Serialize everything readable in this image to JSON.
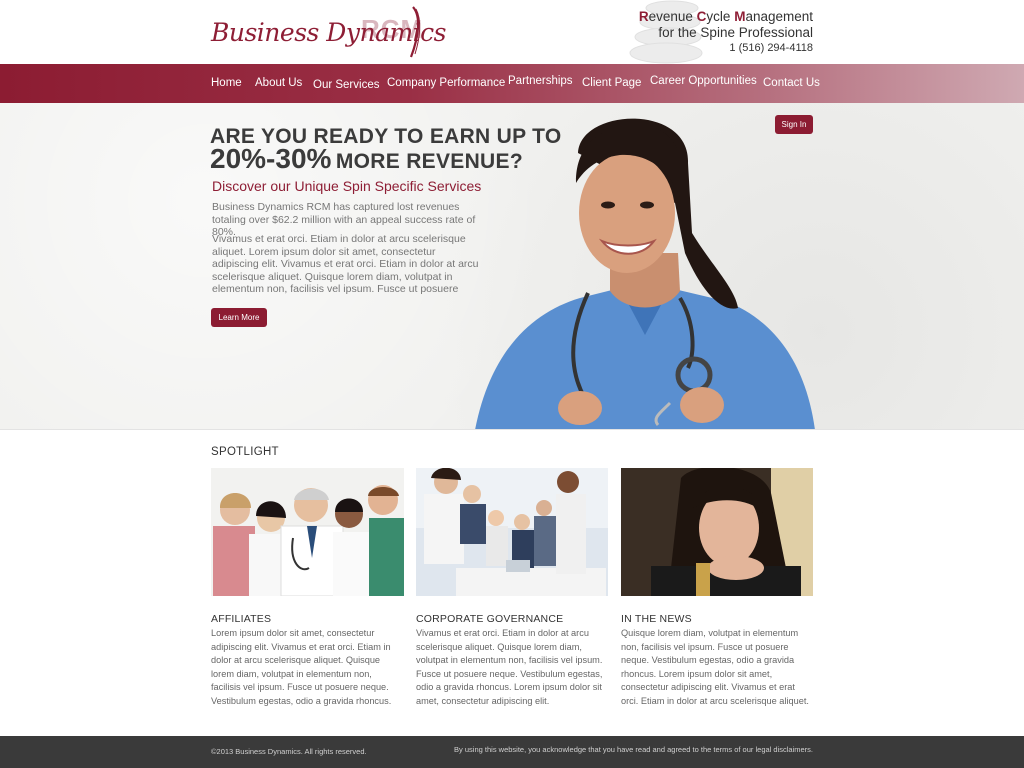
{
  "brand": {
    "logo_text": "Business Dynamics",
    "logo_mark": "RCM",
    "tagline_line1": "Revenue Cycle Management",
    "tagline_line2": "for the Spine Professional",
    "phone": "1 (516) 294-4118",
    "accent_color": "#8c1c32"
  },
  "nav": {
    "items": [
      {
        "label": "Home"
      },
      {
        "label": "About Us"
      },
      {
        "label": "Our Services"
      },
      {
        "label": "Company Performance"
      },
      {
        "label": "Partnerships"
      },
      {
        "label": "Client Page"
      },
      {
        "label": "Career Opportunities"
      },
      {
        "label": "Contact Us"
      }
    ]
  },
  "hero": {
    "headline_line1": "ARE YOU READY TO EARN UP TO",
    "headline_big": "20%-30%",
    "headline_rest": "MORE REVENUE?",
    "subheadline": "Discover our Unique Spin Specific Services",
    "paragraph1": "Business Dynamics RCM has captured lost revenues totaling over $62.2 million with an appeal success rate of 80%.",
    "paragraph2": "Vivamus et erat orci. Etiam in dolor at arcu scelerisque aliquet. Lorem ipsum dolor sit amet, consectetur adipiscing elit. Vivamus et erat orci. Etiam in dolor at arcu scelerisque aliquet. Quisque lorem diam, volutpat in elementum non, facilisis vel ipsum. Fusce ut posuere",
    "learn_more_label": "Learn More",
    "sign_in_label": "Sign In"
  },
  "spotlight": {
    "title": "SPOTLIGHT",
    "cards": [
      {
        "heading": "AFFILIATES",
        "body": "Lorem ipsum dolor sit amet, consectetur adipiscing elit. Vivamus et erat orci. Etiam in dolor at arcu scelerisque aliquet. Quisque lorem diam, volutpat in elementum non, facilisis vel ipsum. Fusce ut posuere neque. Vestibulum egestas, odio a gravida rhoncus."
      },
      {
        "heading": "CORPORATE GOVERNANCE",
        "body": "Vivamus et erat orci. Etiam in dolor at arcu scelerisque aliquet. Quisque lorem diam, volutpat in elementum non, facilisis vel ipsum. Fusce ut posuere neque. Vestibulum egestas, odio a gravida rhoncus. Lorem ipsum dolor sit amet, consectetur adipiscing elit."
      },
      {
        "heading": "IN THE NEWS",
        "body": "Quisque lorem diam, volutpat in elementum non, facilisis vel ipsum. Fusce ut posuere neque. Vestibulum egestas, odio a gravida rhoncus. Lorem ipsum dolor sit amet, consectetur adipiscing elit. Vivamus et erat orci. Etiam in dolor at arcu scelerisque aliquet."
      }
    ]
  },
  "footer": {
    "copyright": "©2013 Business Dynamics. All rights reserved.",
    "legal": "By using this website, you acknowledge that you have read and agreed to the terms of our legal disclaimers."
  }
}
